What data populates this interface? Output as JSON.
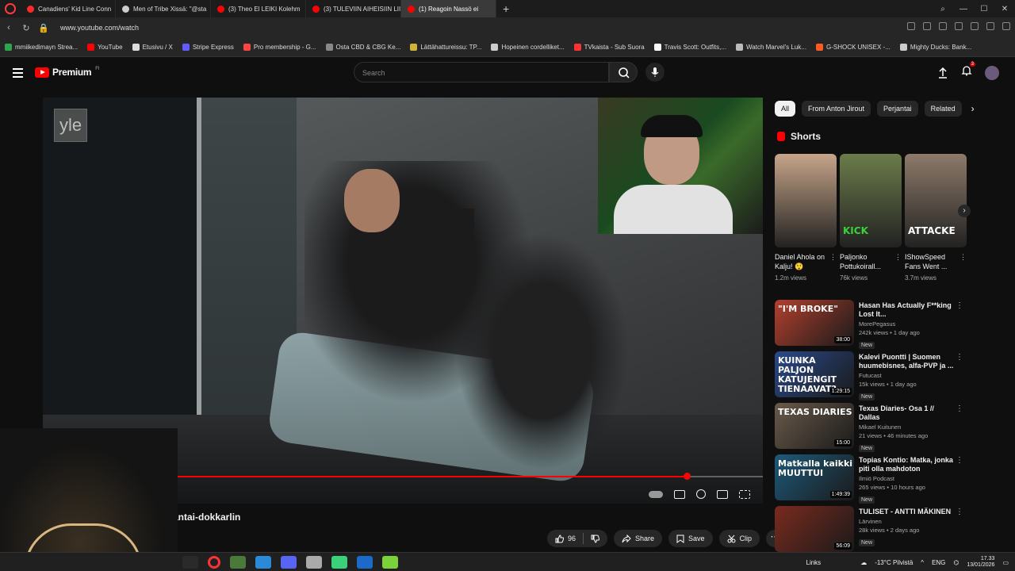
{
  "browser": {
    "tabs": [
      {
        "label": "Canadiens' Kid Line Conn",
        "color": "#ff2b2b"
      },
      {
        "label": "Men of Tribe Xissä: \"@sta",
        "color": "#cccccc"
      },
      {
        "label": "(3) Theo El LEIKI Kolehm",
        "color": "#ff0000"
      },
      {
        "label": "(3) TULEVIIN AIHEISIIN LII",
        "color": "#ff0000"
      },
      {
        "label": "(1) Reagoin Nassö ei",
        "color": "#ff0000",
        "active": true
      }
    ],
    "url": "www.youtube.com/watch",
    "bookmarks": [
      {
        "label": "mmiikedimayn Strea...",
        "color": "#2ea44f"
      },
      {
        "label": "YouTube",
        "color": "#ff0000"
      },
      {
        "label": "Etusivu / X",
        "color": "#dddddd"
      },
      {
        "label": "Stripe Express",
        "color": "#635bff"
      },
      {
        "label": "Pro membership - G...",
        "color": "#ff4444"
      },
      {
        "label": "Osta CBD & CBG Ke...",
        "color": "#888888"
      },
      {
        "label": "Lättähattureissu: TP...",
        "color": "#d1b23a"
      },
      {
        "label": "Hopeinen cordelliket...",
        "color": "#cccccc"
      },
      {
        "label": "TVkaista - Sub Suora",
        "color": "#ff3333"
      },
      {
        "label": "Travis Scott: Outfits,...",
        "color": "#ffffff"
      },
      {
        "label": "Watch Marvel's Luk...",
        "color": "#bbbbbb"
      },
      {
        "label": "G-SHOCK UNISEX -...",
        "color": "#ff5a1f"
      },
      {
        "label": "Mighty Ducks: Bank...",
        "color": "#cccccc"
      }
    ]
  },
  "header": {
    "logo": "Premium",
    "logo_sup": "FI",
    "search_placeholder": "Search",
    "notifications": "3"
  },
  "video": {
    "watermark": "yle",
    "title": "antai-dokkarlin",
    "progress_fraction": 0.88,
    "actions": {
      "likes": "96",
      "share": "Share",
      "save": "Save",
      "clip": "Clip"
    }
  },
  "sidebar": {
    "chips": [
      "All",
      "From Anton Jirout",
      "Perjantai",
      "Related"
    ],
    "shorts_heading": "Shorts",
    "shorts": [
      {
        "title": "Daniel Ahola on Kalju! 😲",
        "views": "1.2m views",
        "bg": "#c7a58a",
        "label": ""
      },
      {
        "title": "Paljonko Pottukoirall...",
        "views": "76k views",
        "bg": "#6c7c4a",
        "label": "KICK"
      },
      {
        "title": "IShowSpeed Fans Went ...",
        "views": "3.7m views",
        "bg": "#8d7a6a",
        "label": "ATTACKE"
      }
    ],
    "recommended": [
      {
        "title": "Hasan Has Actually F**king Lost It...",
        "channel": "MorePegasus",
        "meta": "242k views • 1 day ago",
        "badge": "New",
        "duration": "38:00",
        "thumb_text": "\"I'M BROKE\"",
        "bg": "#b2402e"
      },
      {
        "title": "Kalevi Puontti | Suomen huumebisnes, alfa-PVP ja ...",
        "channel": "Futucast",
        "meta": "15k views • 1 day ago",
        "badge": "New",
        "duration": "1:29:15",
        "thumb_text": "KUINKA PALJON KATUJENGIT TIENAAVAT?",
        "bg": "#2a4a8a"
      },
      {
        "title": "Texas Diaries- Osa 1 // Dallas",
        "channel": "Mikael Kuitunen",
        "meta": "21 views • 46 minutes ago",
        "badge": "New",
        "duration": "15:00",
        "thumb_text": "TEXAS DIARIES",
        "bg": "#6a5a4a"
      },
      {
        "title": "Topias Kontio: Matka, jonka piti olla mahdoton",
        "channel": "Ilmiö Podcast",
        "meta": "265 views • 10 hours ago",
        "badge": "New",
        "duration": "1:49:39",
        "thumb_text": "Matkalla kaikki MUUTTUI",
        "bg": "#1e5a7a"
      },
      {
        "title": "TULISET - ANTTI MÄKINEN",
        "channel": "Lärvinen",
        "meta": "28k views • 2 days ago",
        "badge": "New",
        "duration": "56:09",
        "thumb_text": "",
        "bg": "#7a2a1e"
      }
    ]
  },
  "taskbar": {
    "links": "Links",
    "weather": "-13°C Pilvistä",
    "lang": "ENG",
    "time": "17.33",
    "date": "13/01/2026",
    "apps": [
      "#2a2a2a",
      "#ff3333",
      "#4a7a3a",
      "#2a8ad8",
      "#5865f2",
      "#aaaaaa",
      "#3ad17a",
      "#1b6ac9",
      "#7ad13a"
    ]
  }
}
